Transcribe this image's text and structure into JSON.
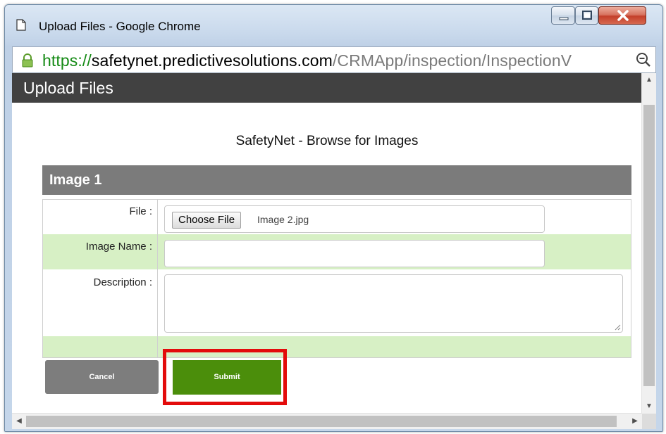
{
  "window": {
    "title": "Upload Files - Google Chrome"
  },
  "address_bar": {
    "scheme": "https://",
    "host": "safetynet.predictivesolutions.com",
    "path": "/CRMApp/inspection/InspectionV"
  },
  "page": {
    "header": "Upload Files",
    "subtitle": "SafetyNet - Browse for Images",
    "section_title": "Image 1"
  },
  "form": {
    "file_label": "File :",
    "choose_file_label": "Choose File",
    "file_name": "Image 2.jpg",
    "image_name_label": "Image Name :",
    "image_name_value": "",
    "description_label": "Description :",
    "description_value": ""
  },
  "buttons": {
    "cancel": "Cancel",
    "submit": "Submit"
  },
  "colors": {
    "header_bg": "#414141",
    "section_bg": "#7b7b7b",
    "row_highlight": "#d7f0c5",
    "submit_bg": "#4b8e0b",
    "cancel_bg": "#7d7d7d",
    "callout_border": "#e30b0b",
    "https_green": "#148a14"
  }
}
